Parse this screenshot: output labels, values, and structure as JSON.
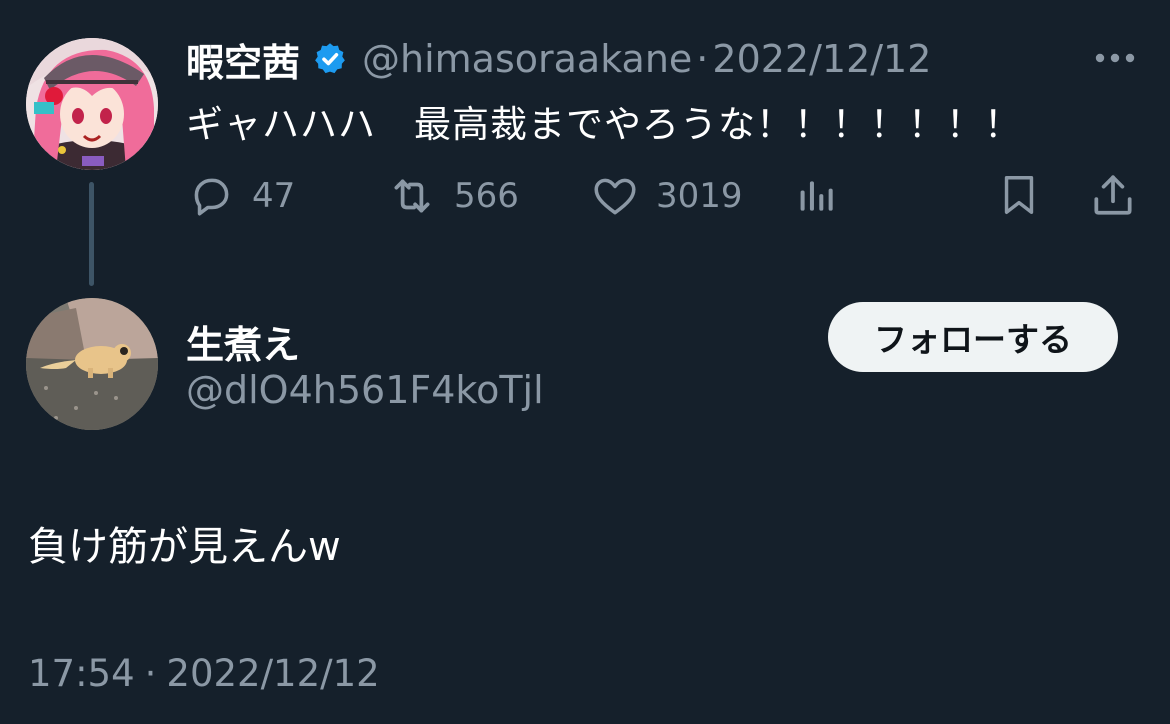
{
  "tweet": {
    "display_name": "暇空茜",
    "handle": "@himasoraakane",
    "separator": "·",
    "date": "2022/12/12",
    "text": "ギャハハハ　最高裁までやろうな！！！！！！！",
    "verified": true,
    "stats": {
      "replies": "47",
      "retweets": "566",
      "likes": "3019"
    },
    "icons": [
      "more-icon",
      "reply-icon",
      "retweet-icon",
      "like-icon",
      "views-icon",
      "bookmark-icon",
      "share-icon",
      "verified-badge-icon"
    ]
  },
  "reply": {
    "display_name": "生煮え",
    "handle": "@dlO4h561F4koTjl",
    "follow_label": "フォローする",
    "text": "負け筋が見えんw",
    "time": "17:54",
    "separator": "·",
    "date": "2022/12/12"
  },
  "colors": {
    "background": "#15202b",
    "muted": "#8b98a5",
    "verified": "#1d9bf0",
    "thread_line": "#3d5466",
    "button_bg": "#eff3f4"
  }
}
